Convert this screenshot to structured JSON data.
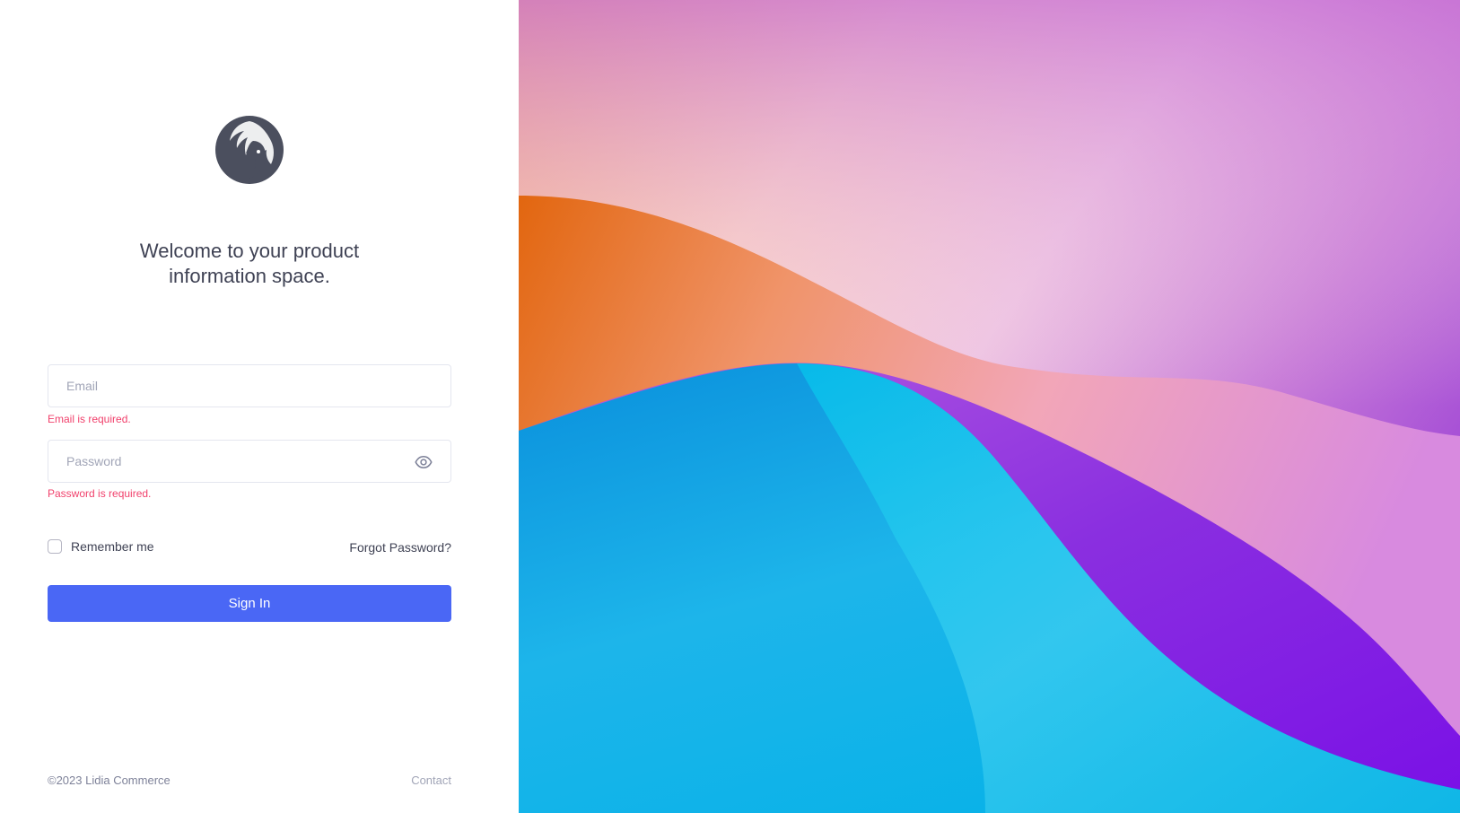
{
  "welcome": {
    "line1": "Welcome to your product",
    "line2": "information space."
  },
  "form": {
    "email_placeholder": "Email",
    "email_value": "",
    "email_error": "Email is required.",
    "password_placeholder": "Password",
    "password_value": "",
    "password_error": "Password is required.",
    "remember_label": "Remember me",
    "remember_checked": false,
    "forgot_label": "Forgot Password?",
    "signin_label": "Sign In"
  },
  "footer": {
    "copyright": "©2023 Lidia Commerce",
    "contact_label": "Contact"
  },
  "icons": {
    "logo": "lion-head-logo",
    "password_toggle": "eye-icon"
  },
  "colors": {
    "primary": "#4a67f5",
    "error": "#f1416c",
    "text": "#3f4254",
    "muted": "#a1a5b7"
  }
}
